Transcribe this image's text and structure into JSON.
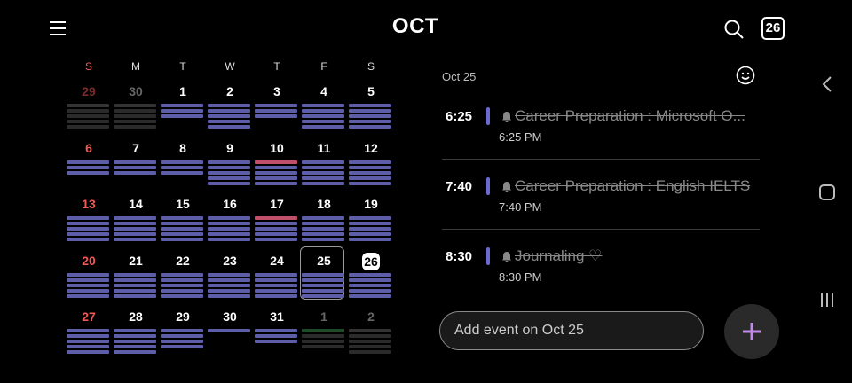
{
  "header": {
    "month": "OCT",
    "today": "26"
  },
  "calendar": {
    "weekdays": [
      "S",
      "M",
      "T",
      "W",
      "T",
      "F",
      "S"
    ],
    "weeks": [
      [
        {
          "n": "29",
          "o": true,
          "b": [
            "#333",
            "#2b2b2b",
            "#2b2b2b",
            "#2b2b2b",
            "#2b2b2b"
          ]
        },
        {
          "n": "30",
          "o": true,
          "b": [
            "#333",
            "#2b2b2b",
            "#2b2b2b",
            "#2b2b2b",
            "#2b2b2b"
          ]
        },
        {
          "n": "1",
          "b": [
            "#5e5ea8",
            "#5e5ea8",
            "#5e5ea8"
          ]
        },
        {
          "n": "2",
          "b": [
            "#5e5ea8",
            "#5e5ea8",
            "#5e5ea8",
            "#5e5ea8",
            "#5e5ea8"
          ]
        },
        {
          "n": "3",
          "b": [
            "#5e5ea8",
            "#5e5ea8",
            "#5e5ea8"
          ]
        },
        {
          "n": "4",
          "b": [
            "#5e5ea8",
            "#5e5ea8",
            "#5e5ea8",
            "#5e5ea8",
            "#5e5ea8"
          ]
        },
        {
          "n": "5",
          "b": [
            "#5e5ea8",
            "#5e5ea8",
            "#5e5ea8",
            "#5e5ea8",
            "#5e5ea8"
          ]
        }
      ],
      [
        {
          "n": "6",
          "b": [
            "#5e5ea8",
            "#5e5ea8",
            "#5e5ea8"
          ]
        },
        {
          "n": "7",
          "b": [
            "#5e5ea8",
            "#5e5ea8",
            "#5e5ea8"
          ]
        },
        {
          "n": "8",
          "b": [
            "#5e5ea8",
            "#5e5ea8",
            "#5e5ea8"
          ]
        },
        {
          "n": "9",
          "b": [
            "#5e5ea8",
            "#5e5ea8",
            "#5e5ea8",
            "#5e5ea8",
            "#5e5ea8"
          ]
        },
        {
          "n": "10",
          "b": [
            "#c0506a",
            "#5e5ea8",
            "#5e5ea8",
            "#5e5ea8",
            "#5e5ea8"
          ]
        },
        {
          "n": "11",
          "b": [
            "#5e5ea8",
            "#5e5ea8",
            "#5e5ea8",
            "#5e5ea8",
            "#5e5ea8"
          ]
        },
        {
          "n": "12",
          "b": [
            "#5e5ea8",
            "#5e5ea8",
            "#5e5ea8",
            "#5e5ea8",
            "#5e5ea8"
          ]
        }
      ],
      [
        {
          "n": "13",
          "b": [
            "#5e5ea8",
            "#5e5ea8",
            "#5e5ea8",
            "#5e5ea8",
            "#5e5ea8"
          ]
        },
        {
          "n": "14",
          "b": [
            "#5e5ea8",
            "#5e5ea8",
            "#5e5ea8",
            "#5e5ea8",
            "#5e5ea8"
          ]
        },
        {
          "n": "15",
          "b": [
            "#5e5ea8",
            "#5e5ea8",
            "#5e5ea8",
            "#5e5ea8",
            "#5e5ea8"
          ]
        },
        {
          "n": "16",
          "b": [
            "#5e5ea8",
            "#5e5ea8",
            "#5e5ea8",
            "#5e5ea8",
            "#5e5ea8"
          ]
        },
        {
          "n": "17",
          "b": [
            "#c0506a",
            "#5e5ea8",
            "#5e5ea8",
            "#5e5ea8",
            "#5e5ea8"
          ]
        },
        {
          "n": "18",
          "b": [
            "#5e5ea8",
            "#5e5ea8",
            "#5e5ea8",
            "#5e5ea8",
            "#5e5ea8"
          ]
        },
        {
          "n": "19",
          "b": [
            "#5e5ea8",
            "#5e5ea8",
            "#5e5ea8",
            "#5e5ea8",
            "#5e5ea8"
          ]
        }
      ],
      [
        {
          "n": "20",
          "b": [
            "#5e5ea8",
            "#5e5ea8",
            "#5e5ea8",
            "#5e5ea8",
            "#5e5ea8"
          ]
        },
        {
          "n": "21",
          "b": [
            "#5e5ea8",
            "#5e5ea8",
            "#5e5ea8",
            "#5e5ea8",
            "#5e5ea8"
          ]
        },
        {
          "n": "22",
          "b": [
            "#5e5ea8",
            "#5e5ea8",
            "#5e5ea8",
            "#5e5ea8",
            "#5e5ea8"
          ]
        },
        {
          "n": "23",
          "b": [
            "#5e5ea8",
            "#5e5ea8",
            "#5e5ea8",
            "#5e5ea8",
            "#5e5ea8"
          ]
        },
        {
          "n": "24",
          "b": [
            "#5e5ea8",
            "#5e5ea8",
            "#5e5ea8",
            "#5e5ea8",
            "#5e5ea8"
          ]
        },
        {
          "n": "25",
          "sel": true,
          "b": [
            "#5e5ea8",
            "#5e5ea8",
            "#5e5ea8",
            "#5e5ea8",
            "#5e5ea8"
          ]
        },
        {
          "n": "26",
          "today": true,
          "b": [
            "#5e5ea8",
            "#5e5ea8",
            "#5e5ea8",
            "#5e5ea8",
            "#5e5ea8"
          ]
        }
      ],
      [
        {
          "n": "27",
          "b": [
            "#5e5ea8",
            "#5e5ea8",
            "#5e5ea8",
            "#5e5ea8",
            "#5e5ea8"
          ]
        },
        {
          "n": "28",
          "b": [
            "#5e5ea8",
            "#5e5ea8",
            "#5e5ea8",
            "#5e5ea8",
            "#5e5ea8"
          ]
        },
        {
          "n": "29",
          "b": [
            "#5e5ea8",
            "#5e5ea8",
            "#5e5ea8",
            "#5e5ea8"
          ]
        },
        {
          "n": "30",
          "b": [
            "#5e5ea8"
          ]
        },
        {
          "n": "31",
          "b": [
            "#5e5ea8",
            "#5e5ea8",
            "#5e5ea8"
          ]
        },
        {
          "n": "1",
          "o": true,
          "b": [
            "#1e4a2a",
            "#2b2b2b",
            "#2b2b2b",
            "#2b2b2b"
          ]
        },
        {
          "n": "2",
          "o": true,
          "b": [
            "#333",
            "#2b2b2b",
            "#2b2b2b",
            "#2b2b2b",
            "#2b2b2b"
          ]
        }
      ]
    ]
  },
  "events_pane": {
    "date_label": "Oct 25",
    "events": [
      {
        "time": "6:25",
        "title": "Career Preparation : Microsoft O...",
        "sub": "6:25 PM"
      },
      {
        "time": "7:40",
        "title": "Career Preparation : English IELTS",
        "sub": "7:40 PM"
      },
      {
        "time": "8:30",
        "title": "Journaling ♡",
        "sub": "8:30 PM"
      }
    ],
    "add_placeholder": "Add event on Oct 25"
  },
  "colors": {
    "accent": "#6a6ad0",
    "fab_plus": "#c08ae8",
    "sunday": "#ef5a56"
  }
}
